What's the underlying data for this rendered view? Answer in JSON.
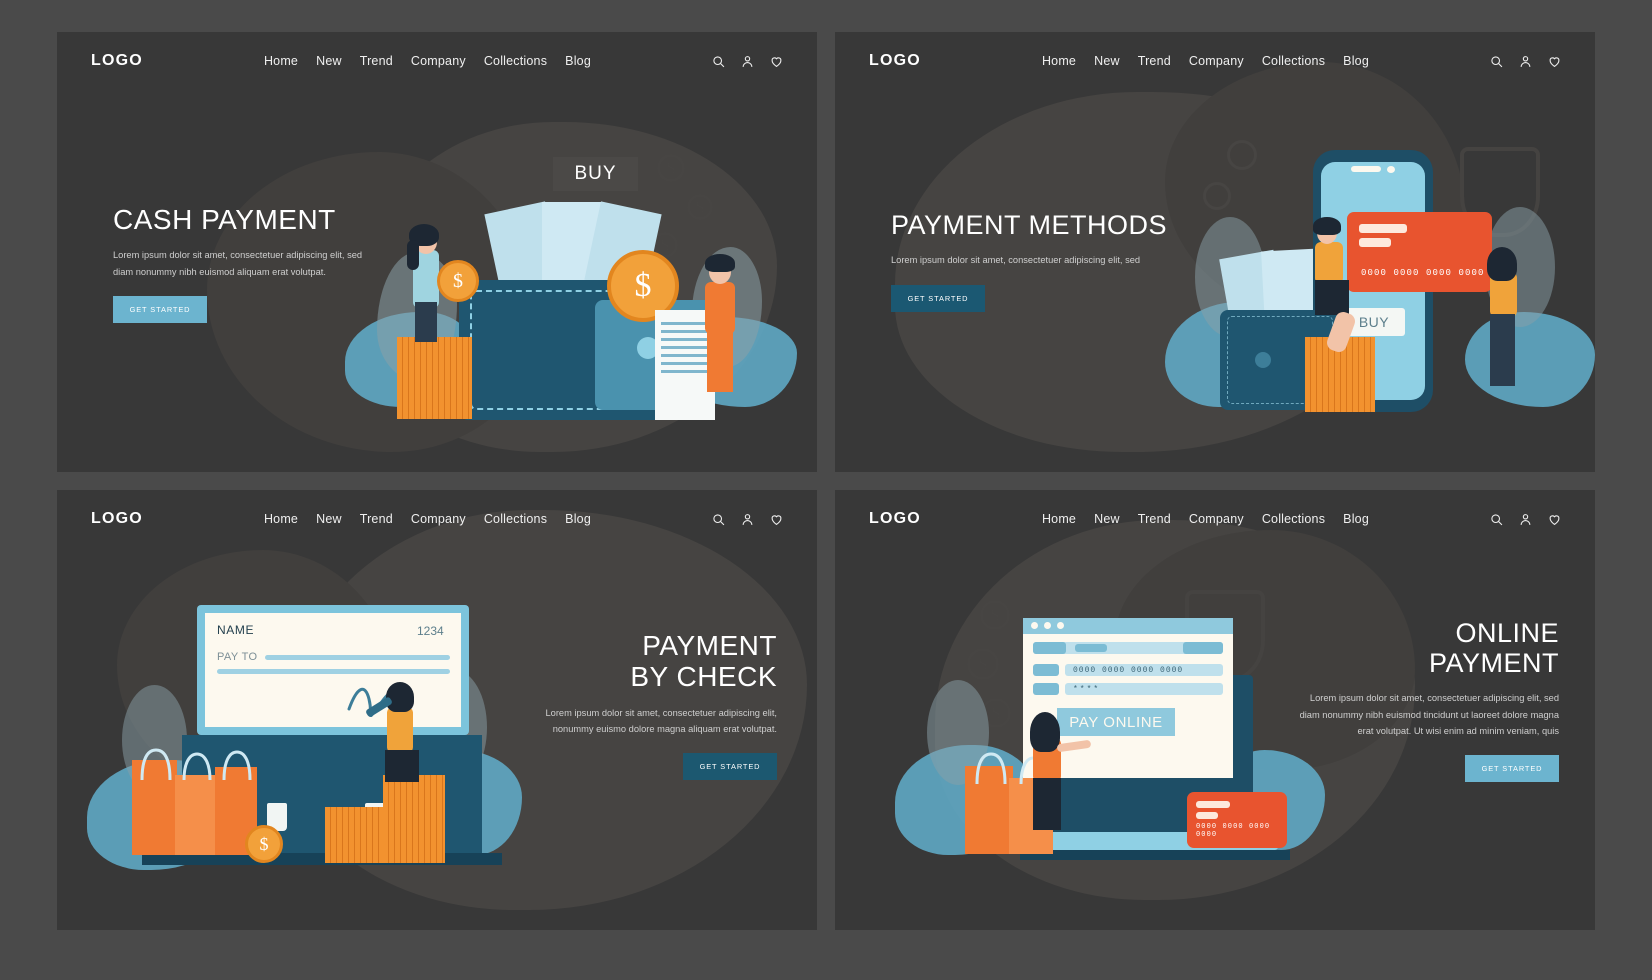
{
  "nav": {
    "logo": "LOGO",
    "links": [
      "Home",
      "New",
      "Trend",
      "Company",
      "Collections",
      "Blog"
    ],
    "icons": [
      "search-icon",
      "user-icon",
      "heart-icon"
    ]
  },
  "cta_label": "GET STARTED",
  "colors": {
    "page_bg": "#4a4a4a",
    "panel_bg": "#383838",
    "accent_light_blue": "#6cb4cf",
    "accent_dark_blue": "#1b5872",
    "accent_teal": "#1c5870",
    "orange": "#f07a33",
    "card_red": "#e8542f",
    "coin_gold": "#f2a13a",
    "text_light": "#ffffff",
    "text_muted": "#cfcfcf"
  },
  "panels": [
    {
      "id": "cash-payment",
      "title": "CASH PAYMENT",
      "body": "Lorem ipsum dolor sit amet, consectetuer adipiscing elit, sed diam nonummy nibh euismod aliquam erat volutpat.",
      "cta": "GET STARTED",
      "cta_color": "#6cb4cf",
      "title_align": "left",
      "illustration": {
        "name": "wallet-cash-illustration",
        "buy_badge": "BUY",
        "banknote_symbol": "$",
        "coin_symbol": "$"
      }
    },
    {
      "id": "payment-methods",
      "title": "PAYMENT METHODS",
      "body": "Lorem ipsum dolor sit amet, consectetuer adipiscing elit, sed",
      "cta": "GET STARTED",
      "cta_color": "#1b5872",
      "title_align": "left",
      "illustration": {
        "name": "phone-card-wallet-illustration",
        "card_number": "0000 0000 0000 0000",
        "buy_badge": "BUY"
      }
    },
    {
      "id": "payment-by-check",
      "title": "PAYMENT BY CHECK",
      "title_lines": [
        "PAYMENT",
        "BY CHECK"
      ],
      "body": "Lorem ipsum dolor sit amet, consectetuer adipiscing elit, nonummy euismo dolore magna aliquam erat volutpat.",
      "cta": "GET STARTED",
      "cta_color": "#1c5870",
      "title_align": "right",
      "illustration": {
        "name": "bank-check-illustration",
        "check_name_label": "NAME",
        "check_number": "1234",
        "check_payto_label": "PAY TO",
        "coin_symbol": "$"
      }
    },
    {
      "id": "online-payment",
      "title": "ONLINE PAYMENT",
      "title_lines": [
        "ONLINE",
        "PAYMENT"
      ],
      "body": "Lorem ipsum dolor sit amet, consectetuer adipiscing elit, sed diam nonummy nibh euismod tincidunt ut laoreet dolore magna erat volutpat. Ut wisi enim ad minim veniam, quis",
      "cta": "GET STARTED",
      "cta_color": "#6cb4cf",
      "title_align": "right",
      "illustration": {
        "name": "laptop-checkout-illustration",
        "card_number_field": "0000 0000 0000 0000",
        "password_field": "****",
        "pay_button": "PAY ONLINE",
        "card_number_on_card": "0000 0000 0000 0000"
      }
    }
  ]
}
